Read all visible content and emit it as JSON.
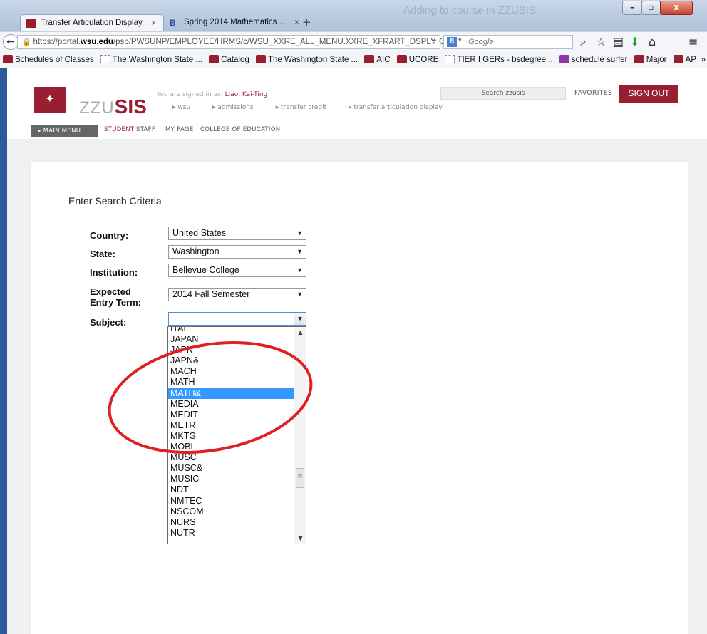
{
  "browser": {
    "title_ghost": "Adding to course in ZZUSIS",
    "tabs": [
      {
        "label": "Transfer Articulation Display",
        "close": "×"
      },
      {
        "label": "Spring 2014 Mathematics ...",
        "close": "×"
      }
    ],
    "new_tab": "+",
    "url": {
      "prefix": "https://portal.",
      "domain": "wsu.edu",
      "path": "/psp/PWSUNP/EMPLOYEE/HRMS/c/WSU_XXRE_ALL_MENU.XXRE_XFRART_DSPLY"
    },
    "search_engine_placeholder": "Google",
    "bookmarks": [
      {
        "label": "Schedules of Classes",
        "icon": "cougar-icon"
      },
      {
        "label": "The Washington State ...",
        "icon": "page-icon"
      },
      {
        "label": "Catalog",
        "icon": "cougar-icon"
      },
      {
        "label": "The Washington State ...",
        "icon": "cougar-icon"
      },
      {
        "label": "AIC",
        "icon": "cougar-icon"
      },
      {
        "label": "UCORE",
        "icon": "cougar-icon"
      },
      {
        "label": "TIER I GERs - bsdegree...",
        "icon": "page-icon"
      },
      {
        "label": "schedule surfer",
        "icon": "purple-icon"
      },
      {
        "label": "Major",
        "icon": "cougar-icon"
      },
      {
        "label": "AP",
        "icon": "cougar-icon"
      }
    ],
    "bookmarks_more": "»"
  },
  "header": {
    "brand_prefix": "ZZU",
    "brand_suffix": "SIS",
    "signed_in_prefix": "You are signed in as: ",
    "signed_in_user": "Liao, Kai-Ting",
    "breadcrumb": [
      "wsu",
      "admissions",
      "transfer credit",
      "transfer articulation display"
    ],
    "search_label": "Search zzusis",
    "favorites": "FAVORITES",
    "sign_out": "SIGN OUT",
    "main_menu": "MAIN MENU",
    "tabs": [
      "STUDENT",
      "STAFF",
      "MY PAGE",
      "COLLEGE OF EDUCATION"
    ],
    "active_tab_color": "#981e32"
  },
  "form": {
    "title": "Enter Search Criteria",
    "country_label": "Country:",
    "country_value": "United States",
    "state_label": "State:",
    "state_value": "Washington",
    "institution_label": "Institution:",
    "institution_value": "Bellevue College",
    "term_label_1": "Expected",
    "term_label_2": "Entry Term:",
    "term_value": "2014 Fall Semester",
    "subject_label": "Subject:",
    "subject_value": ""
  },
  "subject_list": {
    "items": [
      "ITAL",
      "JAPAN",
      "JAPN",
      "JAPN&",
      "MACH",
      "MATH",
      "MATH&",
      "MEDIA",
      "MEDIT",
      "METR",
      "MKTG",
      "MOBL",
      "MUSC",
      "MUSC&",
      "MUSIC",
      "NDT",
      "NMTEC",
      "NSCOM",
      "NURS",
      "NUTR"
    ],
    "selected": "MATH&",
    "highlight_color": "#3399ff"
  },
  "annotation": {
    "color": "#e02020"
  }
}
